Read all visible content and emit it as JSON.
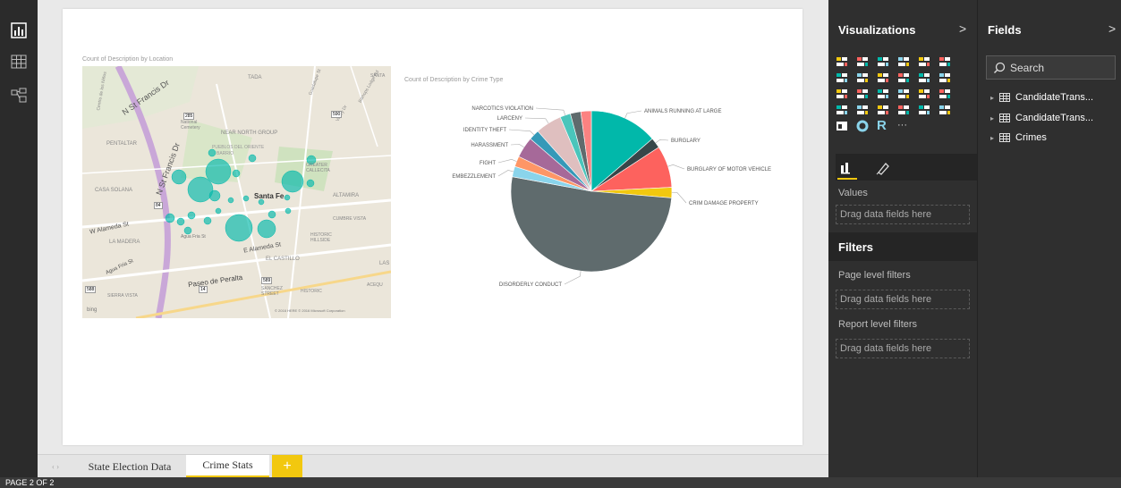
{
  "left_rail": {
    "items": [
      "report-view-icon",
      "data-view-icon",
      "relationships-view-icon"
    ]
  },
  "report": {
    "map_visual": {
      "title": "Count of Description by Location",
      "map_labels": [
        "N St Francis Dr",
        "N St Francis Dr",
        "TADA",
        "Guadalupe St",
        "SANTA",
        "National Cemetery",
        "NEAR NORTH GROUP",
        "PENTALTAR",
        "PUEBLOS DEL ORIENTE",
        "BARRIO",
        "GREATER CALLECITA",
        "CASA SOLANA",
        "Santa Fe",
        "ALTAMIRA",
        "W Alameda St",
        "CUMBRE VISTA",
        "LA MADERA",
        "Agua Fria St",
        "E Alameda St",
        "HISTORIC HILLSIDE",
        "EL CASTILLO",
        "Agua Fria St",
        "Paseo de Peralta",
        "LAS",
        "SIERRA VISTA",
        "SANCHEZ STREET",
        "HISTORIC",
        "ACEQU",
        "Valley Dr",
        "Bishops Lodge Rd",
        "Centro de los Niños"
      ],
      "shields": [
        "285",
        "590",
        "84",
        "589",
        "588",
        "14"
      ],
      "attribution": "© 2016 HERE   © 2016 Microsoft Corporation",
      "bing": "bing"
    },
    "pie_visual": {
      "title": "Count of Description by Crime Type"
    }
  },
  "chart_data": {
    "type": "pie",
    "title": "Count of Description by Crime Type",
    "slices": [
      {
        "label": "ANIMALS RUNNING AT LARGE",
        "value": 13,
        "color": "#01b8aa"
      },
      {
        "label": "BURGLARY",
        "value": 2,
        "color": "#374649"
      },
      {
        "label": "BURGLARY OF MOTOR VEHICLE",
        "value": 8,
        "color": "#fd625e"
      },
      {
        "label": "CRIM DAMAGE PROPERTY",
        "value": 2,
        "color": "#f2c80f"
      },
      {
        "label": "DISORDERLY CONDUCT",
        "value": 49,
        "color": "#5f6b6d"
      },
      {
        "label": "EMBEZZLEMENT",
        "value": 2,
        "color": "#8ad4eb"
      },
      {
        "label": "FIGHT",
        "value": 2,
        "color": "#fe9666"
      },
      {
        "label": "HARASSMENT",
        "value": 4,
        "color": "#a66999"
      },
      {
        "label": "IDENTITY THEFT",
        "value": 2,
        "color": "#3599b8"
      },
      {
        "label": "LARCENY",
        "value": 5,
        "color": "#dfbfbf"
      },
      {
        "label": "NARCOTICS VIOLATION",
        "value": 2,
        "color": "#4ac5bb"
      },
      {
        "label": "",
        "value": 2,
        "color": "#5f6b6d"
      },
      {
        "label": "",
        "value": 2,
        "color": "#fb8281"
      }
    ]
  },
  "tabs": {
    "nav": "‹ ›",
    "items": [
      {
        "label": "State Election Data",
        "active": false
      },
      {
        "label": "Crime Stats",
        "active": true
      }
    ],
    "add": "+"
  },
  "status": {
    "page": "PAGE 2 OF 2"
  },
  "visualizations": {
    "title": "Visualizations",
    "chevron": ">",
    "r_label": "R",
    "more": "···",
    "values_label": "Values",
    "values_drop": "Drag data fields here",
    "filters_title": "Filters",
    "page_filters": "Page level filters",
    "page_drop": "Drag data fields here",
    "report_filters": "Report level filters",
    "report_drop": "Drag data fields here"
  },
  "fields": {
    "title": "Fields",
    "chevron": ">",
    "search_placeholder": "Search",
    "tables": [
      "CandidateTrans...",
      "CandidateTrans...",
      "Crimes"
    ]
  },
  "colors": {
    "teal": "#01b8aa",
    "accent_yellow": "#f2c80f",
    "pane_bg": "#2f2f2f"
  }
}
